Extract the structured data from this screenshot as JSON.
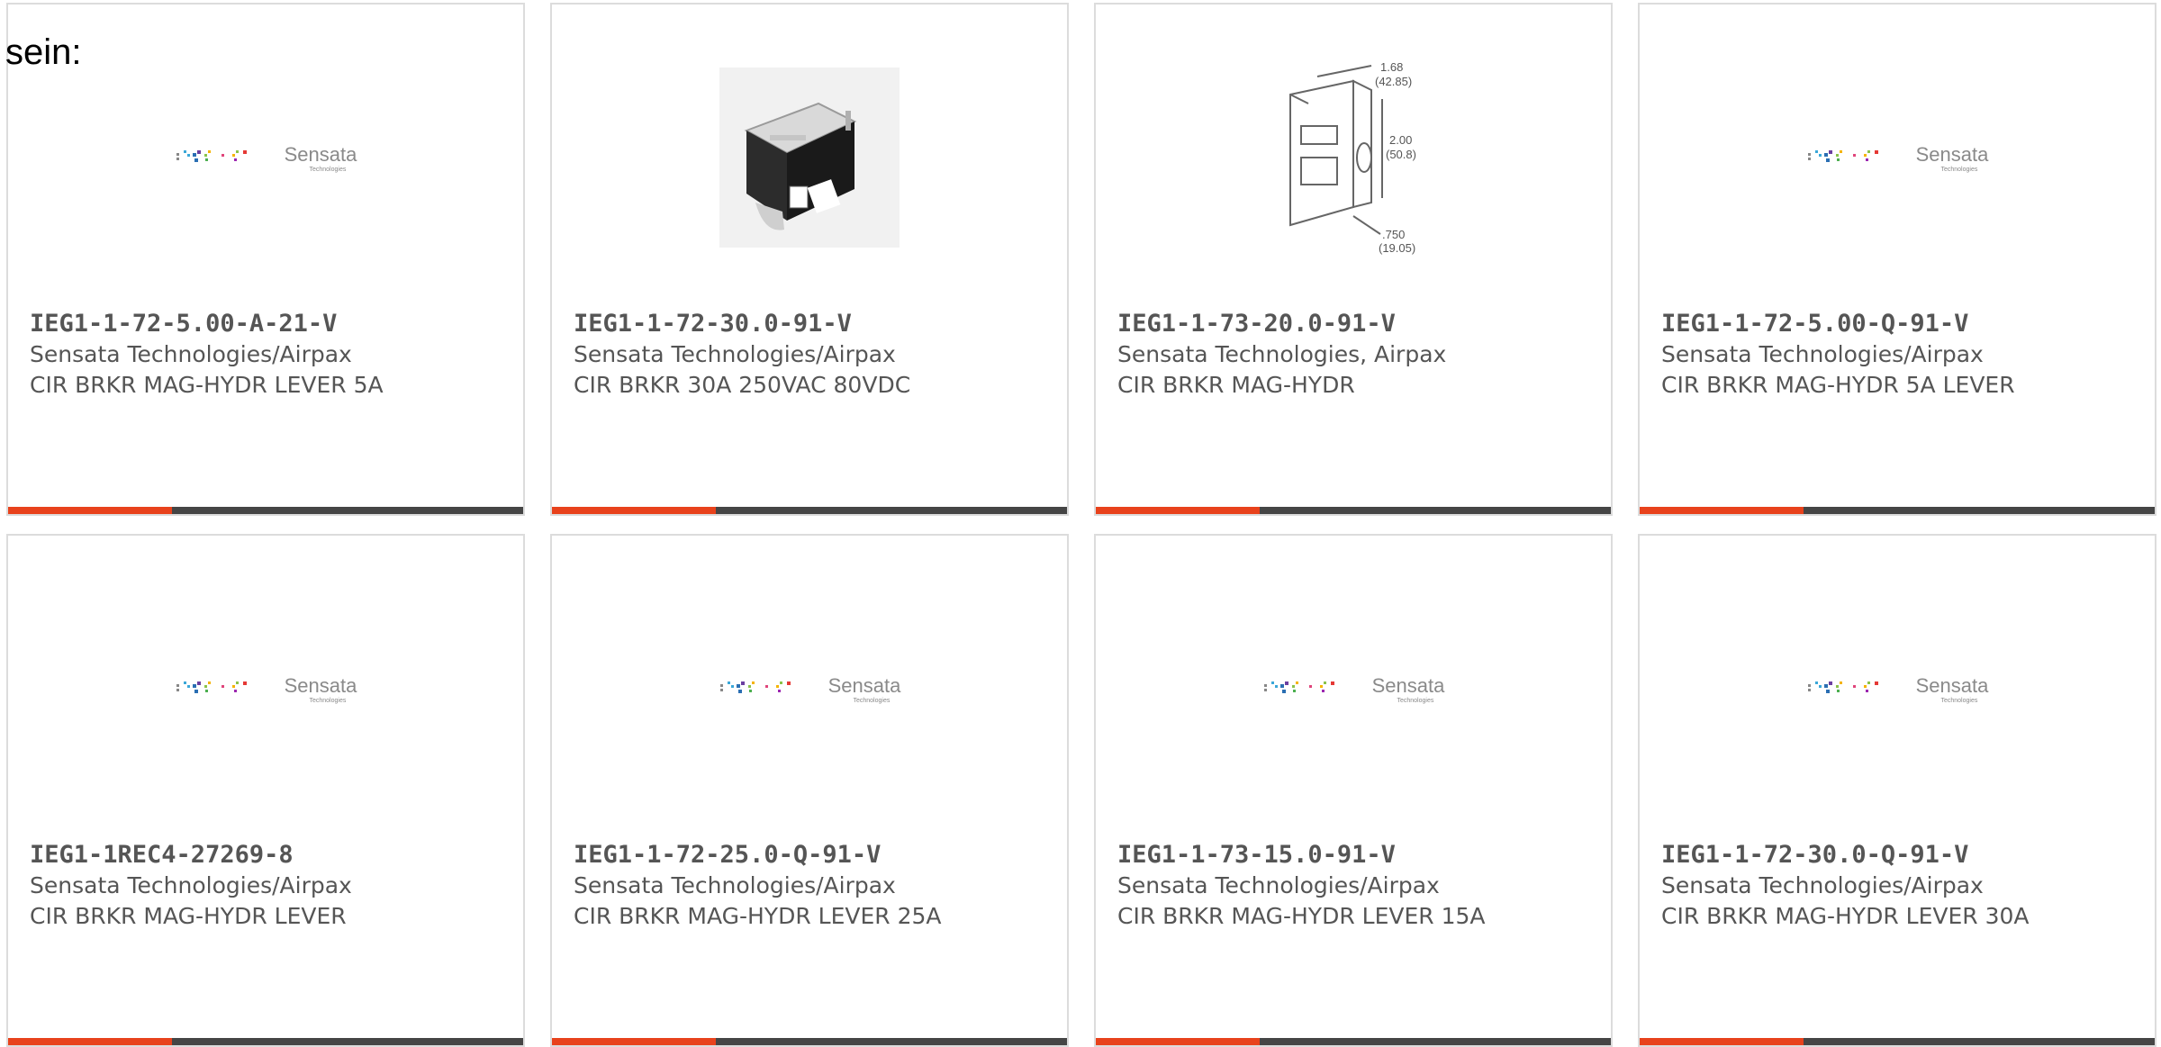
{
  "intro_text": "sein:",
  "colors": {
    "accent_bar": "#e8421c",
    "bar_base": "#454545",
    "card_border": "#dcdcdc",
    "text": "#555555"
  },
  "logo": {
    "brand": "Sensata",
    "sub": "Technologies"
  },
  "products": [
    {
      "part_number": "IEG1-1-72-5.00-A-21-V",
      "manufacturer": "Sensata Technologies/Airpax",
      "description": "CIR BRKR MAG-HYDR LEVER 5A",
      "image": "sensata-logo"
    },
    {
      "part_number": "IEG1-1-72-30.0-91-V",
      "manufacturer": "Sensata Technologies/Airpax",
      "description": "CIR BRKR 30A 250VAC 80VDC",
      "image": "breaker-photo"
    },
    {
      "part_number": "IEG1-1-73-20.0-91-V",
      "manufacturer": "Sensata Technologies, Airpax",
      "description": "CIR BRKR MAG-HYDR",
      "image": "breaker-drawing",
      "drawing_dims": {
        "top": "1.68",
        "top_mm": "(42.85)",
        "right": "2.00",
        "right_mm": "(50.8)",
        "bottom": ".750",
        "bottom_mm": "(19.05)"
      }
    },
    {
      "part_number": "IEG1-1-72-5.00-Q-91-V",
      "manufacturer": "Sensata Technologies/Airpax",
      "description": "CIR BRKR MAG-HYDR 5A LEVER",
      "image": "sensata-logo"
    },
    {
      "part_number": "IEG1-1REC4-27269-8",
      "manufacturer": "Sensata Technologies/Airpax",
      "description": "CIR BRKR MAG-HYDR LEVER",
      "image": "sensata-logo"
    },
    {
      "part_number": "IEG1-1-72-25.0-Q-91-V",
      "manufacturer": "Sensata Technologies/Airpax",
      "description": "CIR BRKR MAG-HYDR LEVER 25A",
      "image": "sensata-logo"
    },
    {
      "part_number": "IEG1-1-73-15.0-91-V",
      "manufacturer": "Sensata Technologies/Airpax",
      "description": "CIR BRKR MAG-HYDR LEVER 15A",
      "image": "sensata-logo"
    },
    {
      "part_number": "IEG1-1-72-30.0-Q-91-V",
      "manufacturer": "Sensata Technologies/Airpax",
      "description": "CIR BRKR MAG-HYDR LEVER 30A",
      "image": "sensata-logo"
    }
  ]
}
